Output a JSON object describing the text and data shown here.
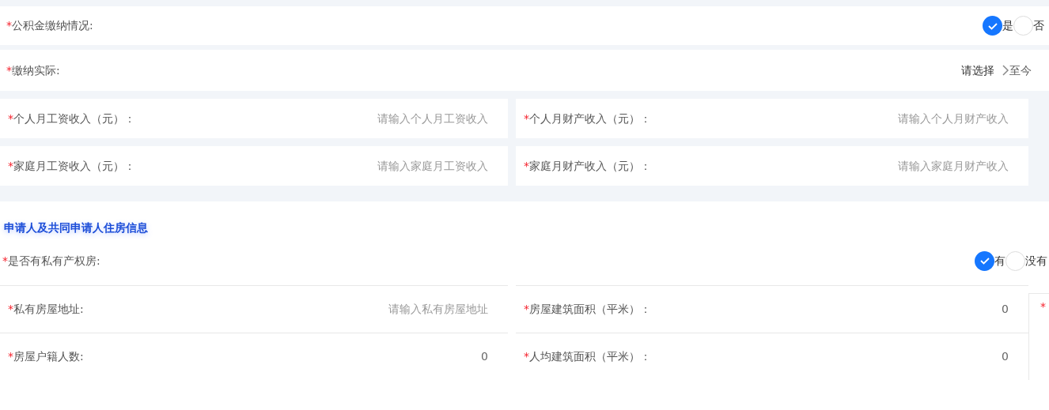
{
  "fund_status": {
    "required_mark": "*",
    "label": "公积金缴纳情况:",
    "options": [
      {
        "label": "是",
        "selected": true
      },
      {
        "label": "否",
        "selected": false
      }
    ]
  },
  "payment_period": {
    "required_mark": "*",
    "label": "缴纳实际:",
    "start": "请选择",
    "end": "至今"
  },
  "income_fields": [
    {
      "required_mark": "*",
      "label": "个人月工资收入（元）：",
      "placeholder": "请输入个人月工资收入"
    },
    {
      "required_mark": "*",
      "label": "个人月财产收入（元）：",
      "placeholder": "请输入个人月财产收入"
    },
    {
      "required_mark": "*",
      "label": "家庭月工资收入（元）：",
      "placeholder": "请输入家庭月工资收入"
    },
    {
      "required_mark": "*",
      "label": "家庭月财产收入（元）：",
      "placeholder": "请输入家庭月财产收入"
    }
  ],
  "housing_section": {
    "title": "申请人及共同申请人住房信息",
    "private_property": {
      "required_mark": "*",
      "label": "是否有私有产权房:",
      "options": [
        {
          "label": "有",
          "selected": true
        },
        {
          "label": "没有",
          "selected": false
        }
      ]
    },
    "fields": [
      {
        "required_mark": "*",
        "label": "私有房屋地址:",
        "placeholder": "请输入私有房屋地址"
      },
      {
        "required_mark": "*",
        "label": "房屋建筑面积（平米）：",
        "value": "0"
      },
      {
        "required_mark": "*",
        "label": "房屋户籍人数:",
        "value": "0"
      },
      {
        "required_mark": "*",
        "label": "人均建筑面积（平米）：",
        "value": "0"
      }
    ]
  },
  "side_panel": {
    "required_mark": "*"
  }
}
